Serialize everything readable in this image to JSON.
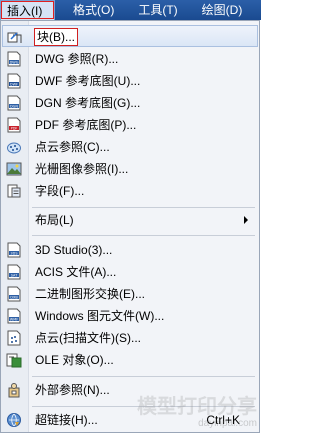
{
  "menubar": {
    "items": [
      {
        "label": "插入(I)"
      },
      {
        "label": "格式(O)"
      },
      {
        "label": "工具(T)"
      },
      {
        "label": "绘图(D)"
      }
    ]
  },
  "menu": {
    "items": [
      {
        "label": "块(B)...",
        "icon": "insert-block-icon"
      },
      {
        "label": "DWG 参照(R)...",
        "icon": "dwg-file-icon"
      },
      {
        "label": "DWF 参考底图(U)...",
        "icon": "dwf-file-icon"
      },
      {
        "label": "DGN 参考底图(G)...",
        "icon": "dgn-file-icon"
      },
      {
        "label": "PDF 参考底图(P)...",
        "icon": "pdf-file-icon"
      },
      {
        "label": "点云参照(C)...",
        "icon": "point-cloud-icon"
      },
      {
        "label": "光栅图像参照(I)...",
        "icon": "raster-image-icon"
      },
      {
        "label": "字段(F)...",
        "icon": "field-icon"
      },
      {
        "label": "布局(L)"
      },
      {
        "label": "3D Studio(3)...",
        "icon": "3ds-file-icon"
      },
      {
        "label": "ACIS 文件(A)...",
        "icon": "sat-file-icon"
      },
      {
        "label": "二进制图形交换(E)...",
        "icon": "dxb-file-icon"
      },
      {
        "label": "Windows 图元文件(W)...",
        "icon": "wmf-file-icon"
      },
      {
        "label": "点云(扫描文件)(S)...",
        "icon": "point-cloud-scan-icon"
      },
      {
        "label": "OLE 对象(O)...",
        "icon": "ole-object-icon"
      },
      {
        "label": "外部参照(N)...",
        "icon": "external-reference-icon"
      },
      {
        "label": "超链接(H)...",
        "icon": "hyperlink-icon",
        "accel": "Ctrl+K"
      }
    ]
  },
  "watermark": {
    "line1": "模型打印分享",
    "line2": "dayinpai.com"
  }
}
